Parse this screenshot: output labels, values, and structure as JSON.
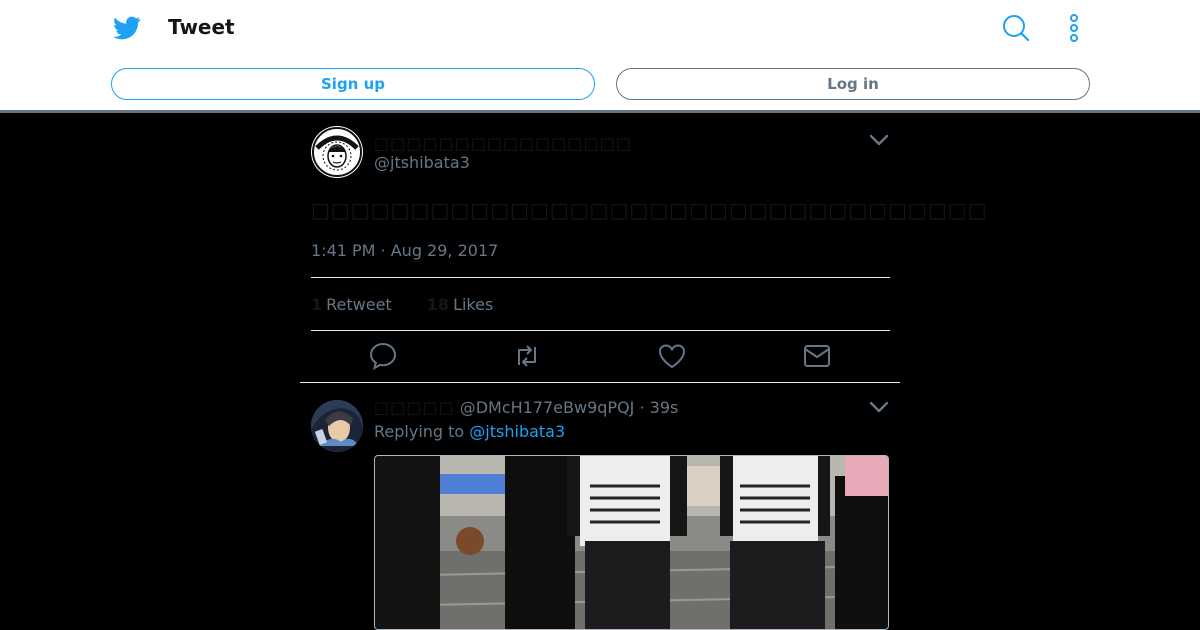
{
  "header": {
    "title": "Tweet",
    "signup_label": "Sign up",
    "login_label": "Log in"
  },
  "tweet": {
    "display_name": "□□□□□□□□□□□□□□□□",
    "handle": "@jtshibata3",
    "text": "□□□□□□□□□□□□□□□□□□□□□□□□□□□□□□□□□□",
    "timestamp": "1:41 PM · Aug 29, 2017",
    "retweet_count": "1",
    "retweet_label": "Retweet",
    "like_count": "18",
    "like_label": "Likes"
  },
  "reply": {
    "display_name": "□□□□□",
    "handle": "@DMcH177eBw9qPQJ",
    "age": "· 39s",
    "replying_prefix": "Replying to",
    "replying_to": "@jtshibata3"
  },
  "colors": {
    "accent": "#1da1f2",
    "muted": "#657786",
    "background": "#000000"
  }
}
